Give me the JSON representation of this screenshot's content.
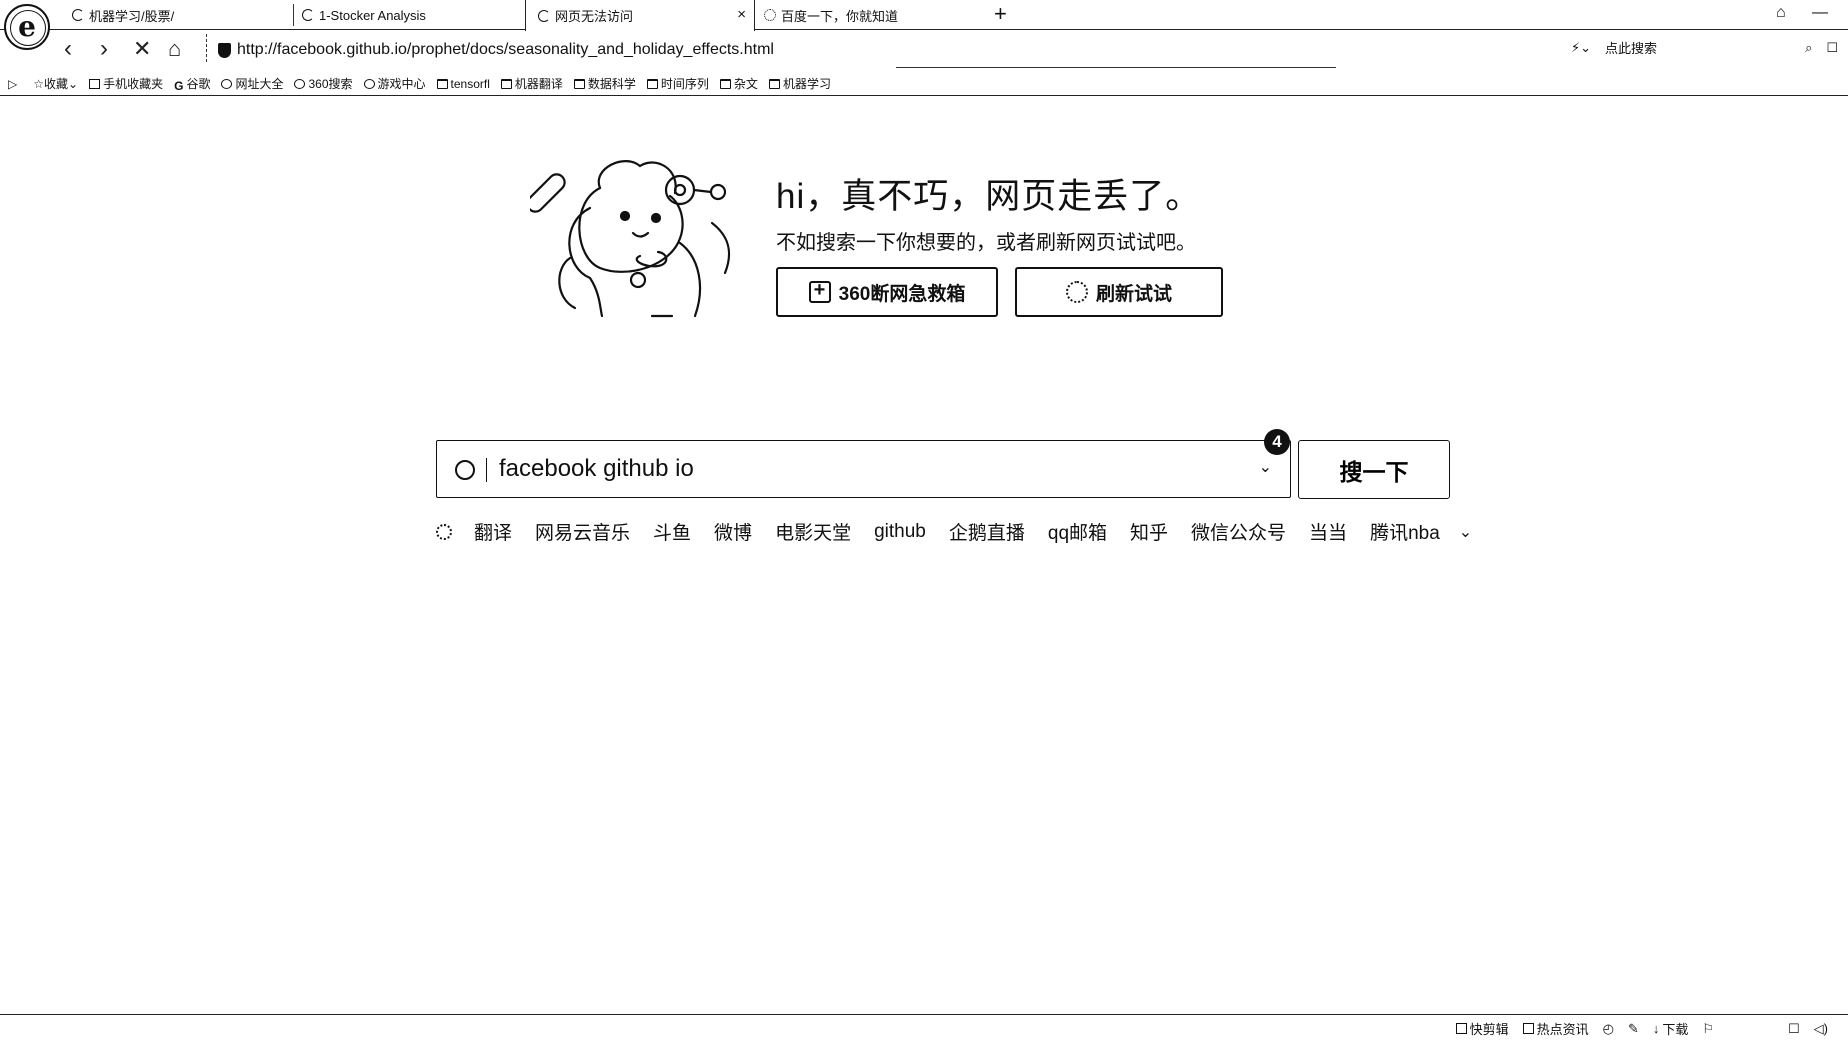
{
  "tabs": [
    {
      "label": "机器学习/股票/"
    },
    {
      "label": "1-Stocker Analysis"
    },
    {
      "label": "网页无法访问"
    },
    {
      "label": "百度一下，你就知道"
    }
  ],
  "address": {
    "url": "http://facebook.github.io/prophet/docs/seasonality_and_holiday_effects.html"
  },
  "toolbar": {
    "search_hint": "点此搜索"
  },
  "bookmarks": [
    {
      "label": "收藏"
    },
    {
      "label": "手机收藏夹"
    },
    {
      "label": "谷歌"
    },
    {
      "label": "网址大全"
    },
    {
      "label": "360搜索"
    },
    {
      "label": "游戏中心"
    },
    {
      "label": "tensorfl"
    },
    {
      "label": "机器翻译"
    },
    {
      "label": "数据科学"
    },
    {
      "label": "时间序列"
    },
    {
      "label": "杂文"
    },
    {
      "label": "机器学习"
    }
  ],
  "error": {
    "title": "hi，真不巧，网页走丢了。",
    "subtitle": "不如搜索一下你想要的，或者刷新网页试试吧。",
    "btn_report": "360断网急救箱",
    "btn_refresh": "刷新试试"
  },
  "search": {
    "value": "facebook github io",
    "button": "搜一下",
    "badge": "4"
  },
  "hot_links": [
    "翻译",
    "网易云音乐",
    "斗鱼",
    "微博",
    "电影天堂",
    "github",
    "企鹅直播",
    "qq邮箱",
    "知乎",
    "微信公众号",
    "当当",
    "腾讯nba"
  ],
  "statusbar": {
    "item1": "快剪辑",
    "item2": "热点资讯",
    "item3": "下载"
  }
}
